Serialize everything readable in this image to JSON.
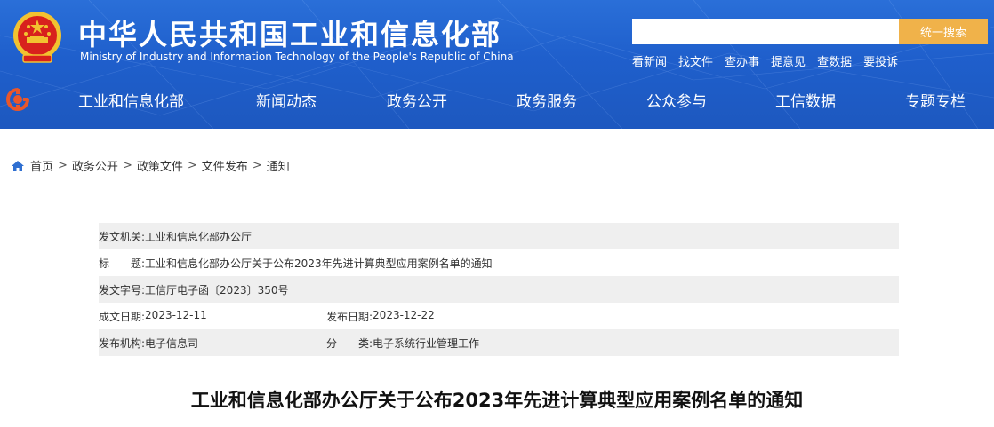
{
  "header": {
    "title_cn": "中华人民共和国工业和信息化部",
    "title_en": "Ministry of Industry and Information Technology of the People's Republic of China",
    "search": {
      "placeholder": "",
      "button_label": "统一搜索"
    },
    "quick_links": [
      "看新闻",
      "找文件",
      "查办事",
      "提意见",
      "查数据",
      "要投诉"
    ],
    "nav": [
      "工业和信息化部",
      "新闻动态",
      "政务公开",
      "政务服务",
      "公众参与",
      "工信数据",
      "专题专栏"
    ],
    "colors": {
      "header_blue": "#1f5fcc",
      "search_button": "#f0b24a"
    }
  },
  "breadcrumb": {
    "icon": "home-icon",
    "items": [
      "首页",
      "政务公开",
      "政策文件",
      "文件发布",
      "通知"
    ],
    "separator": ">"
  },
  "info": {
    "issuer_label": "发文机关:",
    "issuer": "工业和信息化部办公厅",
    "title_label": "标　　题:",
    "title": "工业和信息化部办公厅关于公布2023年先进计算典型应用案例名单的通知",
    "docno_label": "发文字号:",
    "docno": "工信厅电子函〔2023〕350号",
    "created_label": "成文日期:",
    "created": "2023-12-11",
    "published_label": "发布日期:",
    "published": "2023-12-22",
    "org_label": "发布机构:",
    "org": "电子信息司",
    "category_label": "分　　类:",
    "category": "电子系统行业管理工作"
  },
  "document": {
    "title": "工业和信息化部办公厅关于公布2023年先进计算典型应用案例名单的通知"
  }
}
